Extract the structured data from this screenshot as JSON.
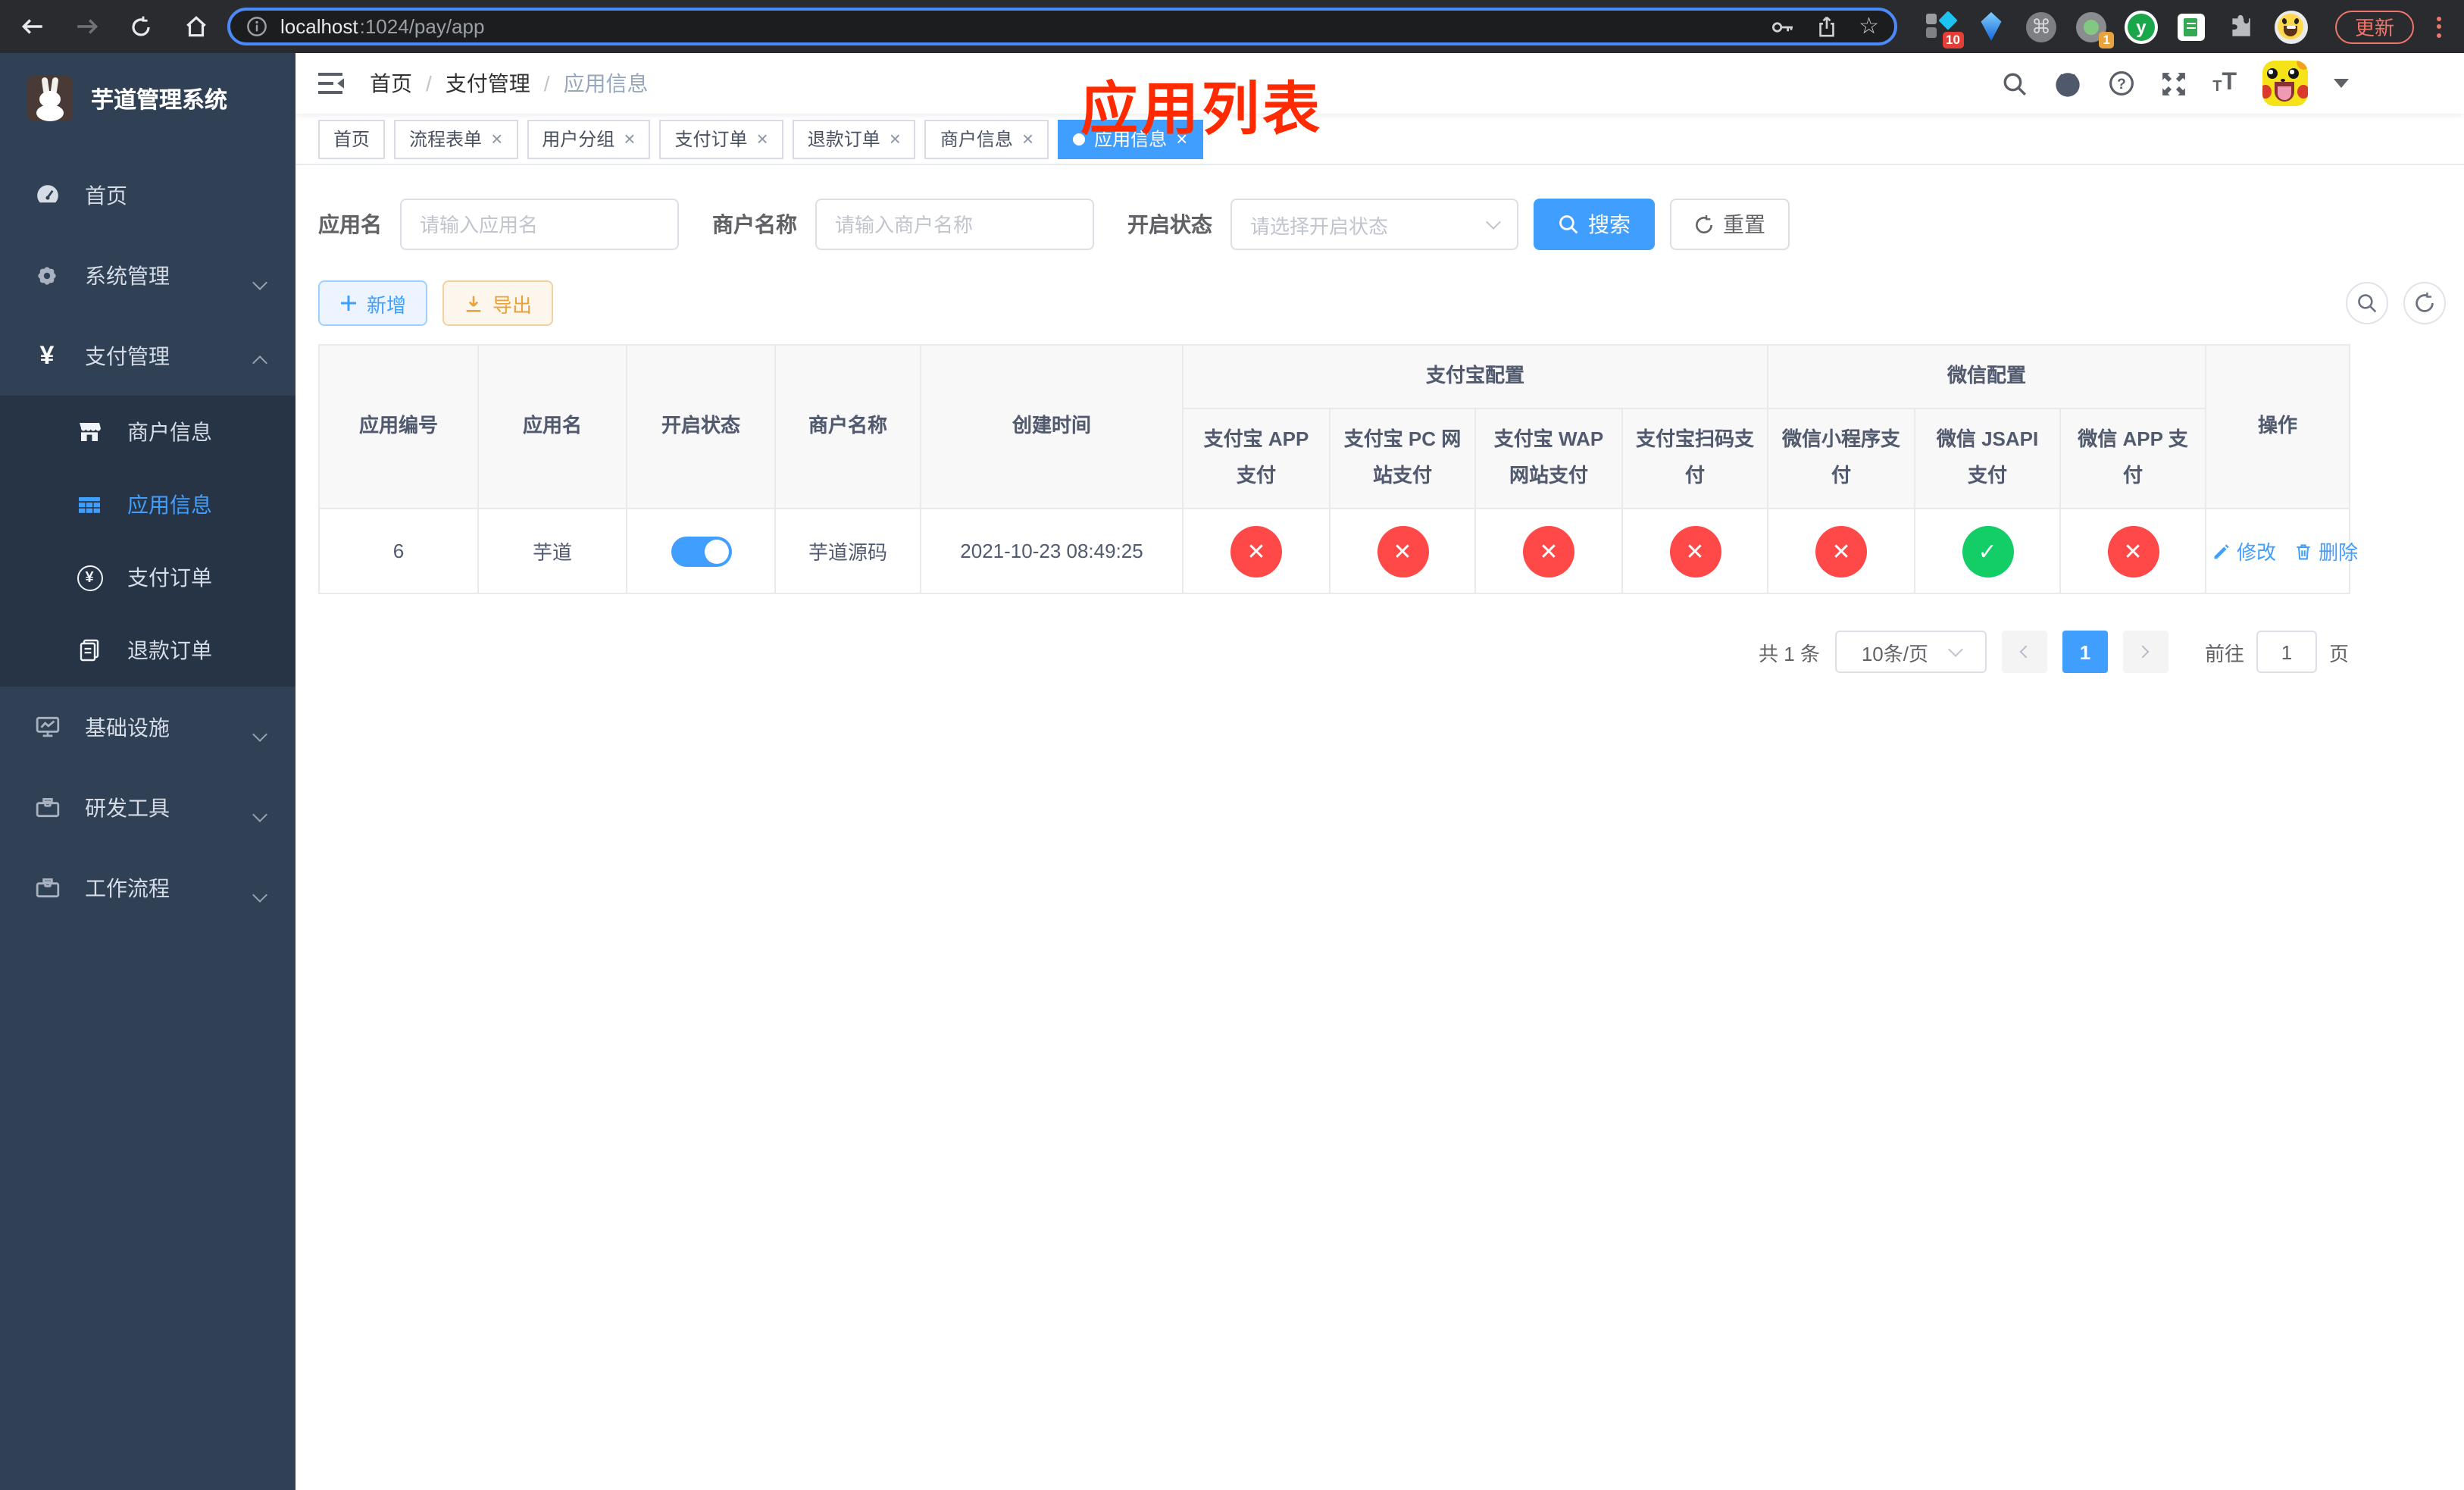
{
  "colors": {
    "accent": "#409eff",
    "success": "#13ce66",
    "danger": "#ff4949",
    "warning": "#e6a23c",
    "red_title": "#ff2a00",
    "sidebar_bg": "#304156",
    "submenu_bg": "#263445"
  },
  "browser": {
    "url_host": "localhost",
    "url_path": ":1024/pay/app",
    "ext_badge_blocks": "10",
    "ext_badge_target": "1",
    "ext_letter": "y",
    "update_label": "更新"
  },
  "sidebar": {
    "title": "芋道管理系统",
    "menu": [
      {
        "label": "首页"
      },
      {
        "label": "系统管理"
      },
      {
        "label": "支付管理"
      },
      {
        "label": "基础设施"
      },
      {
        "label": "研发工具"
      },
      {
        "label": "工作流程"
      }
    ],
    "pay_submenu": [
      {
        "label": "商户信息"
      },
      {
        "label": "应用信息"
      },
      {
        "label": "支付订单"
      },
      {
        "label": "退款订单"
      }
    ]
  },
  "header": {
    "breadcrumb": [
      "首页",
      "支付管理",
      "应用信息"
    ],
    "overlay_title": "应用列表"
  },
  "tabs": [
    {
      "label": "首页"
    },
    {
      "label": "流程表单"
    },
    {
      "label": "用户分组"
    },
    {
      "label": "支付订单"
    },
    {
      "label": "退款订单"
    },
    {
      "label": "商户信息"
    },
    {
      "label": "应用信息"
    }
  ],
  "search": {
    "app_name_label": "应用名",
    "app_name_placeholder": "请输入应用名",
    "merchant_label": "商户名称",
    "merchant_placeholder": "请输入商户名称",
    "status_label": "开启状态",
    "status_placeholder": "请选择开启状态",
    "search_button": "搜索",
    "reset_button": "重置"
  },
  "toolbar": {
    "add_label": "新增",
    "export_label": "导出"
  },
  "table": {
    "columns": [
      "应用编号",
      "应用名",
      "开启状态",
      "商户名称",
      "创建时间"
    ],
    "group_alipay": "支付宝配置",
    "group_wechat": "微信配置",
    "sub_headers": [
      "支付宝 APP 支付",
      "支付宝 PC 网站支付",
      "支付宝 WAP 网站支付",
      "支付宝扫码支付",
      "微信小程序支付",
      "微信 JSAPI 支付",
      "微信 APP 支付"
    ],
    "action_header": "操作",
    "row": {
      "id": "6",
      "name": "芋道",
      "enabled": true,
      "merchant": "芋道源码",
      "create_time": "2021-10-23 08:49:25",
      "statuses": [
        "off",
        "off",
        "off",
        "off",
        "off",
        "on",
        "off"
      ],
      "edit_label": "修改",
      "delete_label": "删除"
    }
  },
  "pagination": {
    "total": "共 1 条",
    "page_size": "10条/页",
    "page": "1",
    "goto_label": "前往",
    "goto_value": "1",
    "goto_unit": "页"
  },
  "icons": {
    "close": "×",
    "check": "✓",
    "cross": "✕",
    "breadcrumb_sep": "/"
  }
}
